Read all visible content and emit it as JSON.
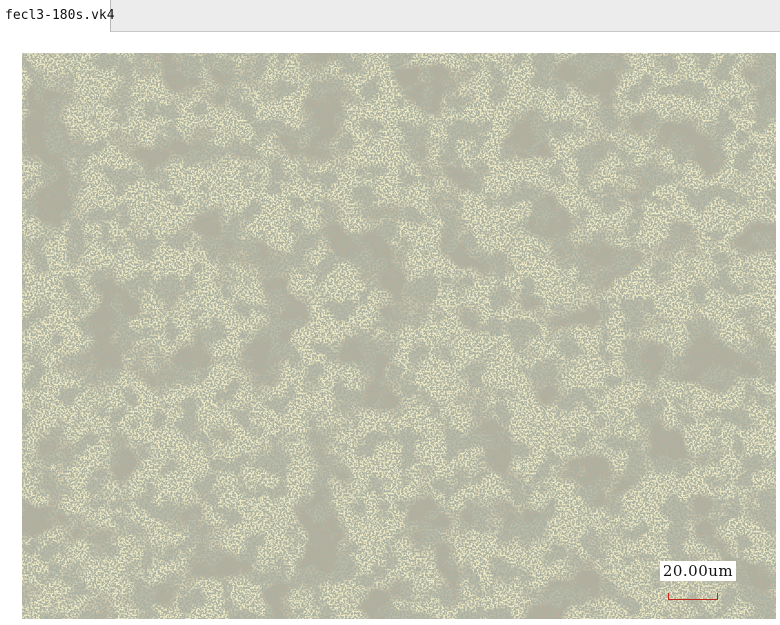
{
  "tab": {
    "filename": "fecl3-180s.vk4"
  },
  "image": {
    "kind": "optical-micrograph",
    "scale_bar_label": "20.00um",
    "scale_bar_color": "#c2281c",
    "dominant_color": "#ece9c1"
  }
}
